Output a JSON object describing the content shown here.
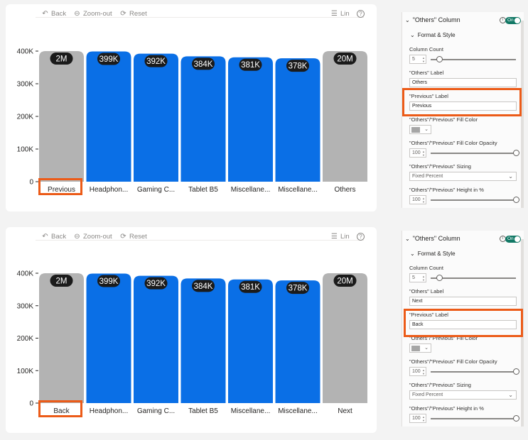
{
  "toolbar": {
    "back": "Back",
    "zoom_out": "Zoom-out",
    "reset": "Reset",
    "scale": "Lin",
    "help": "?"
  },
  "colors": {
    "bar_highlight": "#0a6fe6",
    "bar_other": "#b3b3b3",
    "label_bg": "#1b1b1b",
    "callout": "#ec5b18",
    "toggle_on": "#117865"
  },
  "chart_data": [
    {
      "type": "bar",
      "categories": [
        "Previous",
        "Headphon...",
        "Gaming C...",
        "Tablet B5",
        "Miscellane...",
        "Miscellane...",
        "Others"
      ],
      "values": [
        2000000,
        399000,
        392000,
        384000,
        381000,
        378000,
        20000000
      ],
      "plotted_values": [
        400000,
        399000,
        392000,
        384000,
        381000,
        378000,
        400000
      ],
      "data_labels": [
        "2M",
        "399K",
        "392K",
        "384K",
        "381K",
        "378K",
        "20M"
      ],
      "bar_kinds": [
        "other",
        "main",
        "main",
        "main",
        "main",
        "main",
        "other"
      ],
      "ylim": [
        0,
        400000
      ],
      "yticks": [
        0,
        100000,
        200000,
        300000,
        400000
      ],
      "ytick_labels": [
        "0",
        "100K",
        "200K",
        "300K",
        "400K"
      ],
      "grid": false
    },
    {
      "type": "bar",
      "categories": [
        "Back",
        "Headphon...",
        "Gaming C...",
        "Tablet B5",
        "Miscellane...",
        "Miscellane...",
        "Next"
      ],
      "values": [
        2000000,
        399000,
        392000,
        384000,
        381000,
        378000,
        20000000
      ],
      "plotted_values": [
        400000,
        399000,
        392000,
        384000,
        381000,
        378000,
        400000
      ],
      "data_labels": [
        "2M",
        "399K",
        "392K",
        "384K",
        "381K",
        "378K",
        "20M"
      ],
      "bar_kinds": [
        "other",
        "main",
        "main",
        "main",
        "main",
        "main",
        "other"
      ],
      "ylim": [
        0,
        400000
      ],
      "yticks": [
        0,
        100000,
        200000,
        300000,
        400000
      ],
      "ytick_labels": [
        "0",
        "100K",
        "200K",
        "300K",
        "400K"
      ],
      "grid": false
    }
  ],
  "panels": [
    {
      "title": "\"Others\" Column",
      "toggle": "On",
      "section": "Format & Style",
      "column_count_label": "Column Count",
      "column_count": "5",
      "column_count_slider_pct": 10,
      "others_label_label": "\"Others\" Label",
      "others_label_value": "Others",
      "previous_label_label": "\"Previous\" Label",
      "previous_label_value": "Previous",
      "fill_color_label": "\"Others\"/\"Previous\" Fill Color",
      "fill_opacity_label": "\"Others\"/\"Previous\" Fill Color Opacity",
      "fill_opacity": "100",
      "fill_opacity_slider_pct": 100,
      "sizing_label": "\"Others\"/\"Previous\" Sizing",
      "sizing_value": "Fixed Percent",
      "height_label": "\"Others\"/\"Previous\" Height in %",
      "height": "100",
      "height_slider_pct": 100
    },
    {
      "title": "\"Others\" Column",
      "toggle": "On",
      "section": "Format & Style",
      "column_count_label": "Column Count",
      "column_count": "5",
      "column_count_slider_pct": 10,
      "others_label_label": "\"Others\" Label",
      "others_label_value": "Next",
      "previous_label_label": "\"Previous\" Label",
      "previous_label_value": "Back",
      "fill_color_label": "\"Others\"/\"Previous\" Fill Color",
      "fill_opacity_label": "\"Others\"/\"Previous\" Fill Color Opacity",
      "fill_opacity": "100",
      "fill_opacity_slider_pct": 100,
      "sizing_label": "\"Others\"/\"Previous\" Sizing",
      "sizing_value": "Fixed Percent",
      "height_label": "\"Others\"/\"Previous\" Height in %",
      "height": "100",
      "height_slider_pct": 100
    }
  ]
}
